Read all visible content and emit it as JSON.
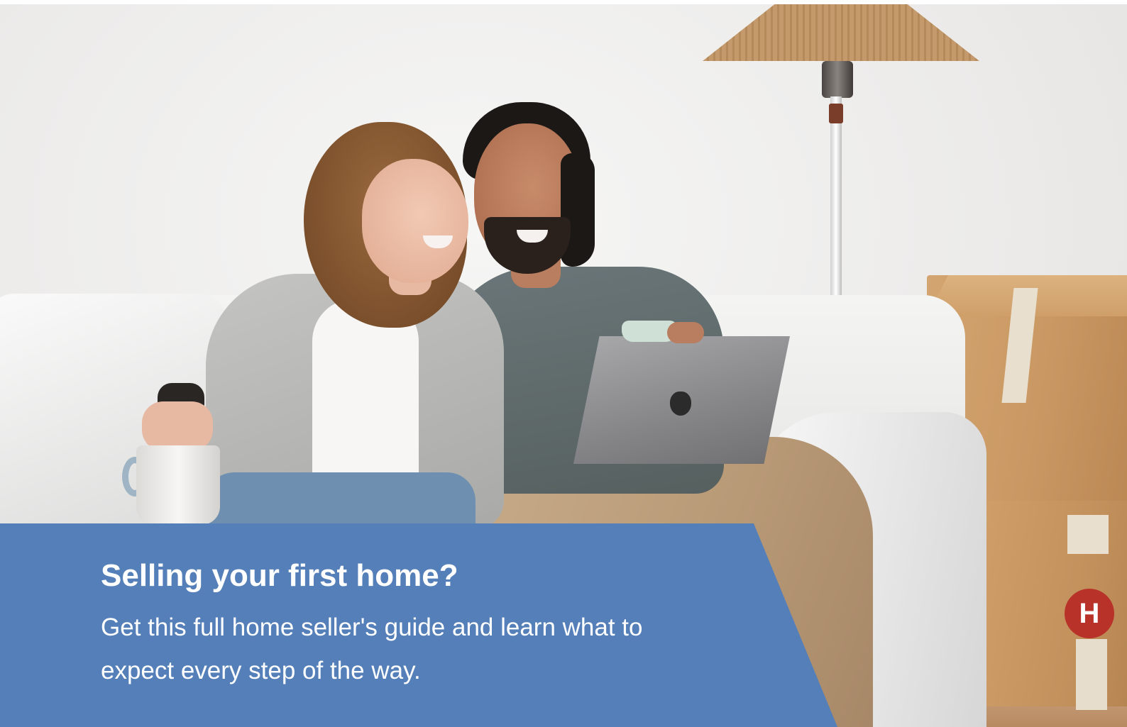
{
  "promo": {
    "title": "Selling your first home?",
    "description": "Get this full home seller's guide and learn what to expect every step of the way."
  },
  "hero_image": {
    "box_logo_letter": "H"
  },
  "colors": {
    "panel_blue": "#547fb8",
    "text": "#ffffff",
    "background": "#ffffff"
  }
}
